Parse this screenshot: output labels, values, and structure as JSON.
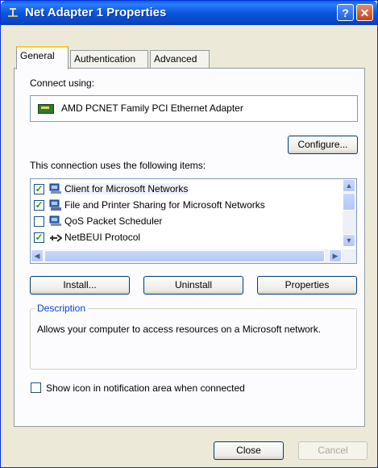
{
  "title_bar": {
    "title": "Net Adapter 1 Properties",
    "help_label": "?",
    "close_label": "✕"
  },
  "tabs": [
    {
      "label": "General",
      "active": true
    },
    {
      "label": "Authentication",
      "active": false
    },
    {
      "label": "Advanced",
      "active": false
    }
  ],
  "general": {
    "connect_using_label": "Connect using:",
    "adapter_name": "AMD PCNET Family PCI Ethernet Adapter",
    "configure_label": "Configure...",
    "items_label": "This connection uses the following items:",
    "items": [
      {
        "label": "Client for Microsoft Networks",
        "checked": true,
        "checkmark": "✓",
        "icon": "network-client-icon"
      },
      {
        "label": "File and Printer Sharing for Microsoft Networks",
        "checked": true,
        "checkmark": "✓",
        "icon": "file-printer-sharing-icon"
      },
      {
        "label": "QoS Packet Scheduler",
        "checked": false,
        "checkmark": "",
        "icon": "qos-scheduler-icon"
      },
      {
        "label": "NetBEUI Protocol",
        "checked": true,
        "checkmark": "✓",
        "icon": "protocol-icon"
      }
    ],
    "install_label": "Install...",
    "uninstall_label": "Uninstall",
    "properties_label": "Properties",
    "description_title": "Description",
    "description_text": "Allows your computer to access resources on a Microsoft network.",
    "show_icon_label": "Show icon in notification area when connected",
    "show_icon_checked": false
  },
  "footer": {
    "close_label": "Close",
    "cancel_label": "Cancel"
  },
  "colors": {
    "titlebar": "#0a56dc",
    "dialog_bg": "#ece9d8",
    "tab_highlight": "#ffc83c",
    "group_title": "#0046d5",
    "button_border": "#003c74",
    "checkmark": "#21a121"
  }
}
